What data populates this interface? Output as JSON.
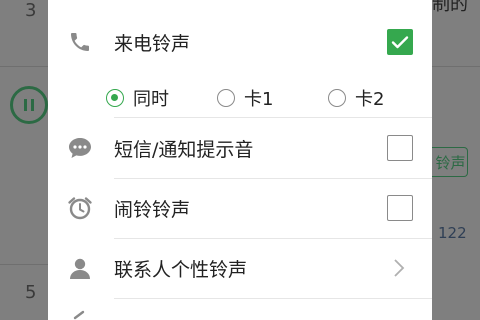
{
  "background": {
    "item_number_top": "3",
    "item_number_bottom": "5",
    "right_button_label": "铃声",
    "right_count": "122",
    "top_right_text": "制的"
  },
  "dialog": {
    "items": [
      {
        "label": "来电铃声",
        "icon": "phone-icon",
        "control": "checkbox",
        "checked": true
      },
      {
        "label": "短信/通知提示音",
        "icon": "message-icon",
        "control": "checkbox",
        "checked": false
      },
      {
        "label": "闹铃铃声",
        "icon": "alarm-clock-icon",
        "control": "checkbox",
        "checked": false
      },
      {
        "label": "联系人个性铃声",
        "icon": "contact-person-icon",
        "control": "chevron"
      }
    ],
    "sim_options": [
      {
        "label": "同时",
        "selected": true
      },
      {
        "label": "卡1",
        "selected": false
      },
      {
        "label": "卡2",
        "selected": false
      }
    ]
  },
  "colors": {
    "accent": "#35a84e",
    "overlay": "#7f7f7f"
  }
}
